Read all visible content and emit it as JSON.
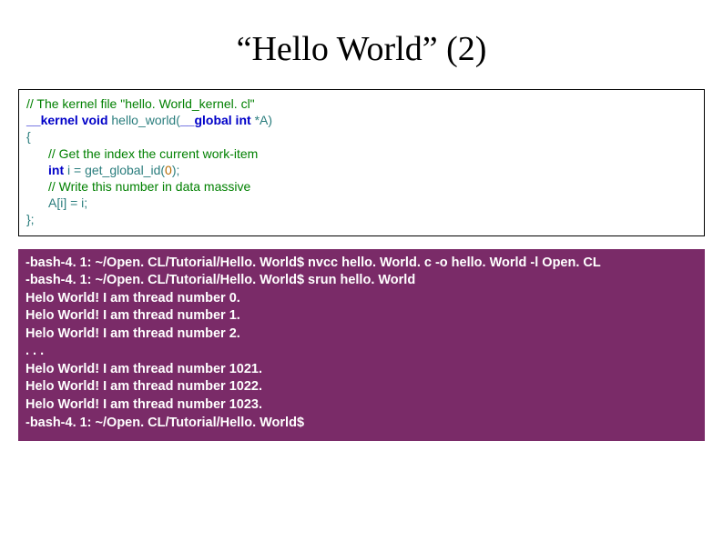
{
  "title": "“Hello World” (2)",
  "code": {
    "line1": "// The kernel file \"hello. World_kernel. cl\"",
    "line2a": "__kernel",
    "line2b": " void ",
    "line2c": "hello_world(",
    "line2d": "__global",
    "line2e": " int ",
    "line2f": "*A)",
    "line3": "{",
    "line4": "// Get the index the current work-item",
    "line5a": "int ",
    "line5b": "i = get_global_id(",
    "line5c": "0",
    "line5d": ");",
    "line6": "// Write this number in data massive",
    "line7": "A[i] = i;",
    "line8": "};"
  },
  "terminal": [
    "-bash-4. 1: ~/Open. CL/Tutorial/Hello. World$ nvcc hello. World. c -o hello. World -l Open. CL",
    "-bash-4. 1: ~/Open. CL/Tutorial/Hello. World$ srun hello. World",
    "Helo World! I am thread number 0.",
    "Helo World! I am thread number 1.",
    "Helo World! I am thread number 2.",
    ". . .",
    "Helo World! I am thread number 1021.",
    "Helo World! I am thread number 1022.",
    "Helo World! I am thread number 1023.",
    "-bash-4. 1: ~/Open. CL/Tutorial/Hello. World$"
  ]
}
